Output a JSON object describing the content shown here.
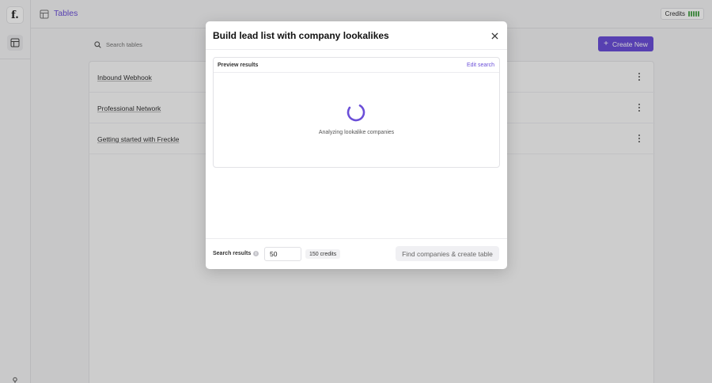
{
  "app": {
    "logo_text": "f.",
    "page_title": "Tables",
    "credits_label": "Credits"
  },
  "toolbar": {
    "search_placeholder": "Search tables",
    "create_label": "Create New"
  },
  "tables": [
    {
      "name": "Inbound Webhook"
    },
    {
      "name": "Professional Network"
    },
    {
      "name": "Getting started with Freckle"
    }
  ],
  "modal": {
    "title": "Build lead list with company lookalikes",
    "preview_label": "Preview results",
    "edit_search_label": "Edit search",
    "loading_text": "Analyzing lookalike companies",
    "search_results_label": "Search results",
    "search_results_value": "50",
    "credits_cost": "150 credits",
    "submit_label": "Find companies & create table"
  },
  "colors": {
    "accent": "#6b4fd8",
    "credits_bar": "#52a852"
  }
}
